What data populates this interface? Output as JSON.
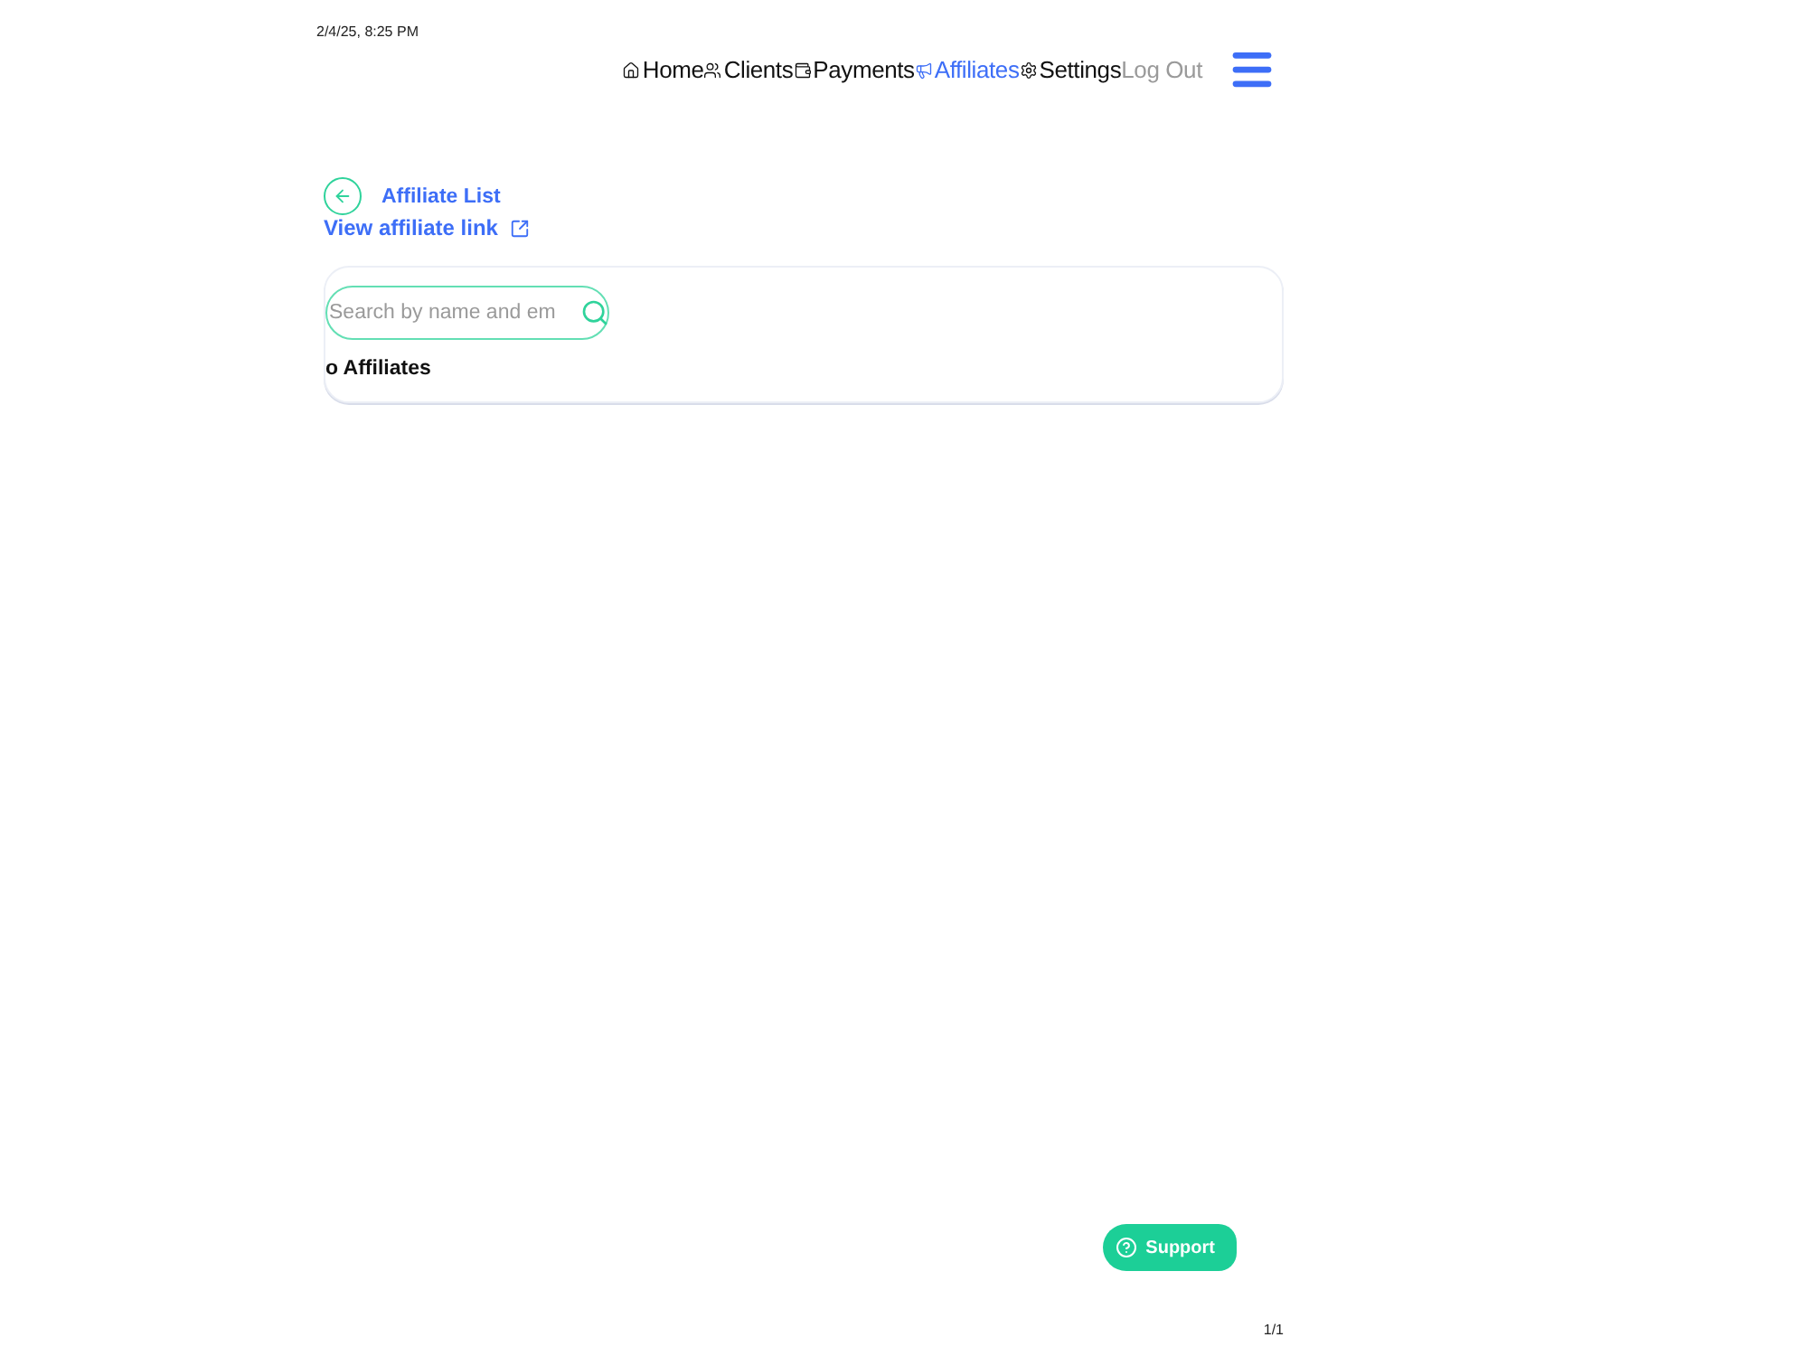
{
  "timestamp": "2/4/25, 8:25 PM",
  "nav": {
    "items": [
      {
        "label": "Home",
        "selected": false
      },
      {
        "label": "Clients",
        "selected": false
      },
      {
        "label": "Payments",
        "selected": false
      },
      {
        "label": "Affiliates",
        "selected": true
      },
      {
        "label": "Settings",
        "selected": false
      }
    ],
    "logout": "Log Out"
  },
  "header": {
    "title": "Affiliate List",
    "link": "View affiliate link"
  },
  "search": {
    "placeholder": "Search by name and em"
  },
  "empty_message": "o Affiliates",
  "support_button": "Support",
  "page_number": "1/1"
}
